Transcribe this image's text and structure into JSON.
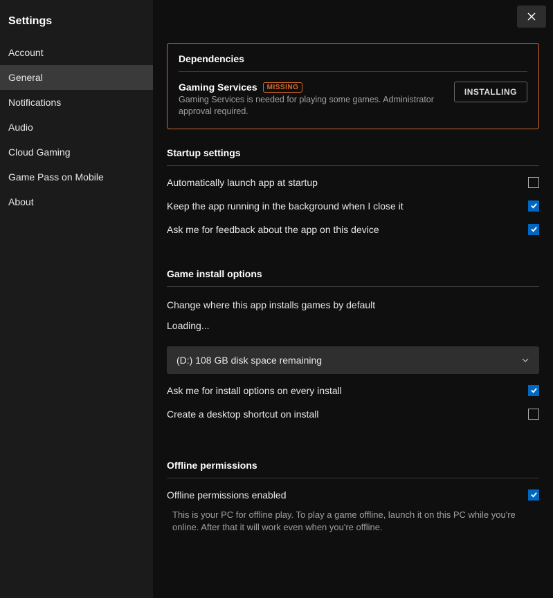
{
  "sidebar": {
    "title": "Settings",
    "items": [
      {
        "label": "Account",
        "active": false
      },
      {
        "label": "General",
        "active": true
      },
      {
        "label": "Notifications",
        "active": false
      },
      {
        "label": "Audio",
        "active": false
      },
      {
        "label": "Cloud Gaming",
        "active": false
      },
      {
        "label": "Game Pass on Mobile",
        "active": false
      },
      {
        "label": "About",
        "active": false
      }
    ]
  },
  "dependencies": {
    "heading": "Dependencies",
    "name": "Gaming Services",
    "badge": "MISSING",
    "description": "Gaming Services is needed for playing some games. Administrator approval required.",
    "button": "INSTALLING"
  },
  "startup": {
    "heading": "Startup settings",
    "options": [
      {
        "label": "Automatically launch app at startup",
        "checked": false
      },
      {
        "label": "Keep the app running in the background when I close it",
        "checked": true
      },
      {
        "label": "Ask me for feedback about the app on this device",
        "checked": true
      }
    ]
  },
  "install": {
    "heading": "Game install options",
    "change_text": "Change where this app installs games by default",
    "loading": "Loading...",
    "dropdown_value": "(D:) 108 GB disk space remaining",
    "options": [
      {
        "label": "Ask me for install options on every install",
        "checked": true
      },
      {
        "label": "Create a desktop shortcut on install",
        "checked": false
      }
    ]
  },
  "offline": {
    "heading": "Offline permissions",
    "option_label": "Offline permissions enabled",
    "option_checked": true,
    "description": "This is your PC for offline play. To play a game offline, launch it on this PC while you're online. After that it will work even when you're offline."
  }
}
